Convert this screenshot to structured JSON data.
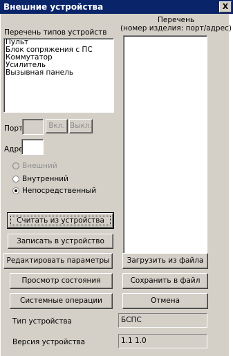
{
  "window": {
    "title": "Внешние устройства",
    "close_label": "X"
  },
  "device_types": {
    "label": "Перечень типов устройств",
    "items": [
      "Пульт",
      "Блок сопряжения с ПС",
      "Коммутатор",
      "Усилитель",
      "Вызывная панель"
    ]
  },
  "device_list": {
    "label_line1": "Перечень",
    "label_line2": "(номер изделия: порт/адрес)",
    "items": []
  },
  "port": {
    "label": "Порт",
    "value": "",
    "on_label": "Вкл.",
    "off_label": "Выкл."
  },
  "address": {
    "label": "Адрес",
    "value": ""
  },
  "connection": {
    "options": [
      {
        "label": "Внешний",
        "selected": false,
        "enabled": false
      },
      {
        "label": "Внутренний",
        "selected": false,
        "enabled": true
      },
      {
        "label": "Непосредственный",
        "selected": true,
        "enabled": true
      }
    ]
  },
  "buttons": {
    "read_device": "Считать из устройства",
    "write_device": "Записать в устройство",
    "edit_params": "Редактировать параметры",
    "load_file": "Загрузить из файла",
    "view_state": "Просмотр состояния",
    "save_file": "Сохранить в файл",
    "system_ops": "Системные операции",
    "cancel": "Отмена"
  },
  "device_info": {
    "type_label": "Тип устройства",
    "type_value": "БСПС",
    "version_label": "Версия устройства",
    "version_value": "1.1 1.0"
  }
}
